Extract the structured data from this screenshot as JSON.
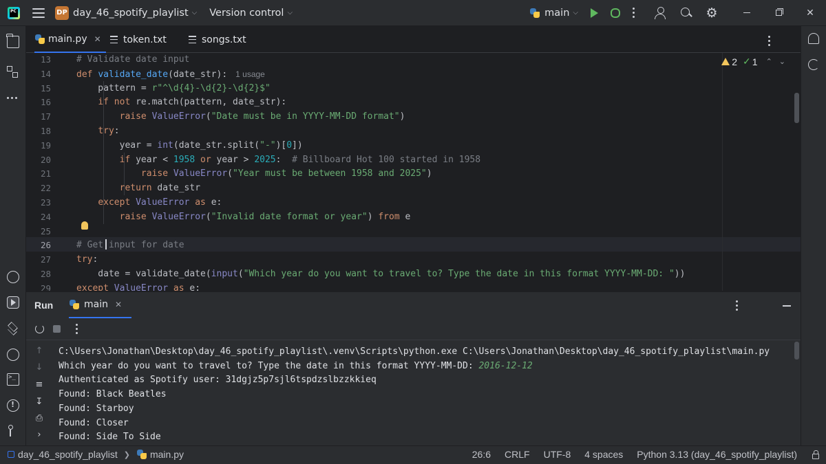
{
  "window": {
    "project_badge": "DP",
    "project_name": "day_46_spotify_playlist",
    "vcs_label": "Version control",
    "branch": "main"
  },
  "tabs": [
    {
      "label": "main.py",
      "icon": "python-file-icon",
      "active": true
    },
    {
      "label": "token.txt",
      "icon": "text-file-icon",
      "active": false
    },
    {
      "label": "songs.txt",
      "icon": "text-file-icon",
      "active": false
    }
  ],
  "inspections": {
    "warnings": "2",
    "ok": "1"
  },
  "editor": {
    "current_line": 26,
    "lines": [
      {
        "n": "13",
        "tokens": [
          [
            "cm",
            "# Validate date input"
          ]
        ]
      },
      {
        "n": "14",
        "tokens": [
          [
            "kw",
            "def "
          ],
          [
            "fn",
            "validate_date"
          ],
          [
            "",
            "(date_str):"
          ]
        ],
        "hint": "1 usage"
      },
      {
        "n": "15",
        "tokens": [
          [
            "",
            "    pattern = "
          ],
          [
            "st",
            "r\"^\\d{4}-\\d{2}-\\d{2}$\""
          ]
        ]
      },
      {
        "n": "16",
        "tokens": [
          [
            "",
            "    "
          ],
          [
            "kw",
            "if not "
          ],
          [
            "",
            "re.match(pattern, date_str):"
          ]
        ]
      },
      {
        "n": "17",
        "tokens": [
          [
            "",
            "        "
          ],
          [
            "kw",
            "raise "
          ],
          [
            "bi",
            "ValueError"
          ],
          [
            "",
            "("
          ],
          [
            "st",
            "\"Date must be in YYYY-MM-DD format\""
          ],
          [
            "",
            ")"
          ]
        ]
      },
      {
        "n": "18",
        "tokens": [
          [
            "",
            "    "
          ],
          [
            "kw",
            "try"
          ],
          [
            "",
            ":"
          ]
        ]
      },
      {
        "n": "19",
        "tokens": [
          [
            "",
            "        year = "
          ],
          [
            "bi",
            "int"
          ],
          [
            "",
            "(date_str.split("
          ],
          [
            "st",
            "\"-\""
          ],
          [
            "",
            ")["
          ],
          [
            "num",
            "0"
          ],
          [
            "",
            "])"
          ]
        ]
      },
      {
        "n": "20",
        "tokens": [
          [
            "",
            "        "
          ],
          [
            "kw",
            "if "
          ],
          [
            "",
            "year < "
          ],
          [
            "num",
            "1958 "
          ],
          [
            "kw",
            "or "
          ],
          [
            "",
            "year > "
          ],
          [
            "num",
            "2025"
          ],
          [
            "",
            ":  "
          ],
          [
            "cm",
            "# Billboard Hot 100 started in 1958"
          ]
        ]
      },
      {
        "n": "21",
        "tokens": [
          [
            "",
            "            "
          ],
          [
            "kw",
            "raise "
          ],
          [
            "bi",
            "ValueError"
          ],
          [
            "",
            "("
          ],
          [
            "st",
            "\"Year must be between 1958 and 2025\""
          ],
          [
            "",
            ")"
          ]
        ]
      },
      {
        "n": "22",
        "tokens": [
          [
            "",
            "        "
          ],
          [
            "kw",
            "return "
          ],
          [
            "",
            "date_str"
          ]
        ]
      },
      {
        "n": "23",
        "tokens": [
          [
            "",
            "    "
          ],
          [
            "kw",
            "except "
          ],
          [
            "bi",
            "ValueError "
          ],
          [
            "kw",
            "as "
          ],
          [
            "",
            "e:"
          ]
        ]
      },
      {
        "n": "24",
        "tokens": [
          [
            "",
            "        "
          ],
          [
            "kw",
            "raise "
          ],
          [
            "bi",
            "ValueError"
          ],
          [
            "",
            "("
          ],
          [
            "st",
            "\"Invalid date format or year\""
          ],
          [
            "",
            ") "
          ],
          [
            "kw",
            "from "
          ],
          [
            "",
            "e"
          ]
        ]
      },
      {
        "n": "25",
        "tokens": [
          [
            "",
            ""
          ]
        ]
      },
      {
        "n": "26",
        "tokens": [
          [
            "cm",
            "# Get input for date"
          ]
        ]
      },
      {
        "n": "27",
        "tokens": [
          [
            "kw",
            "try"
          ],
          [
            "",
            ":"
          ]
        ]
      },
      {
        "n": "28",
        "tokens": [
          [
            "",
            "    date = validate_date("
          ],
          [
            "bi",
            "input"
          ],
          [
            "",
            "("
          ],
          [
            "st",
            "\"Which year do you want to travel to? Type the date in this format YYYY-MM-DD: \""
          ],
          [
            "",
            "))"
          ]
        ]
      },
      {
        "n": "29",
        "tokens": [
          [
            "kw",
            "except "
          ],
          [
            "bi",
            "ValueError "
          ],
          [
            "kw",
            "as "
          ],
          [
            "",
            "e:"
          ]
        ]
      }
    ]
  },
  "run_panel": {
    "title": "Run",
    "tab_label": "main",
    "output": [
      {
        "text": "C:\\Users\\Jonathan\\Desktop\\day_46_spotify_playlist\\.venv\\Scripts\\python.exe C:\\Users\\Jonathan\\Desktop\\day_46_spotify_playlist\\main.py"
      },
      {
        "text": "Which year do you want to travel to? Type the date in this format YYYY-MM-DD: ",
        "input": "2016-12-12"
      },
      {
        "text": "Authenticated as Spotify user: 31dgjz5p7sjl6tspdzslbzzkkieq"
      },
      {
        "text": "Found: Black Beatles"
      },
      {
        "text": "Found: Starboy"
      },
      {
        "text": "Found: Closer"
      },
      {
        "text": "Found: Side To Side"
      }
    ]
  },
  "statusbar": {
    "project": "day_46_spotify_playlist",
    "file": "main.py",
    "position": "26:6",
    "line_sep": "CRLF",
    "encoding": "UTF-8",
    "indent": "4 spaces",
    "interpreter": "Python 3.13 (day_46_spotify_playlist)"
  }
}
